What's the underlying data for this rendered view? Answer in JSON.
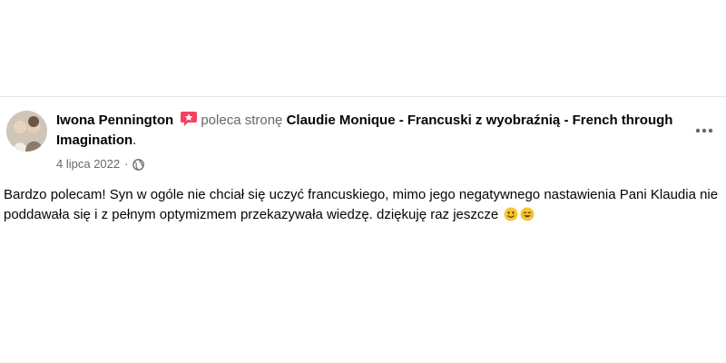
{
  "post": {
    "author": "Iwona Pennington",
    "recommends_text": "poleca stronę",
    "page_name": "Claudie Monique - Francuski z wyobraźnią - French through Imagination",
    "trailing_period": ".",
    "date": "4 lipca 2022",
    "meta_separator": "·",
    "audience_icon": "globe-icon",
    "badge_icon": "recommend-badge-icon",
    "more_icon": "more-horizontal-icon",
    "body": "Bardzo polecam! Syn w ogóle nie chciał się uczyć francuskiego, mimo jego negatywnego nastawienia Pani Klaudia nie poddawała się i z pełnym optymizmem przekazywała wiedzę. dziękuję raz jeszcze",
    "emojis": [
      "smiling-face-icon",
      "smiling-eyes-face-icon"
    ]
  },
  "colors": {
    "text_primary": "#050505",
    "text_secondary": "#65676b",
    "badge": "#f3425f",
    "divider": "#e4e6eb"
  }
}
